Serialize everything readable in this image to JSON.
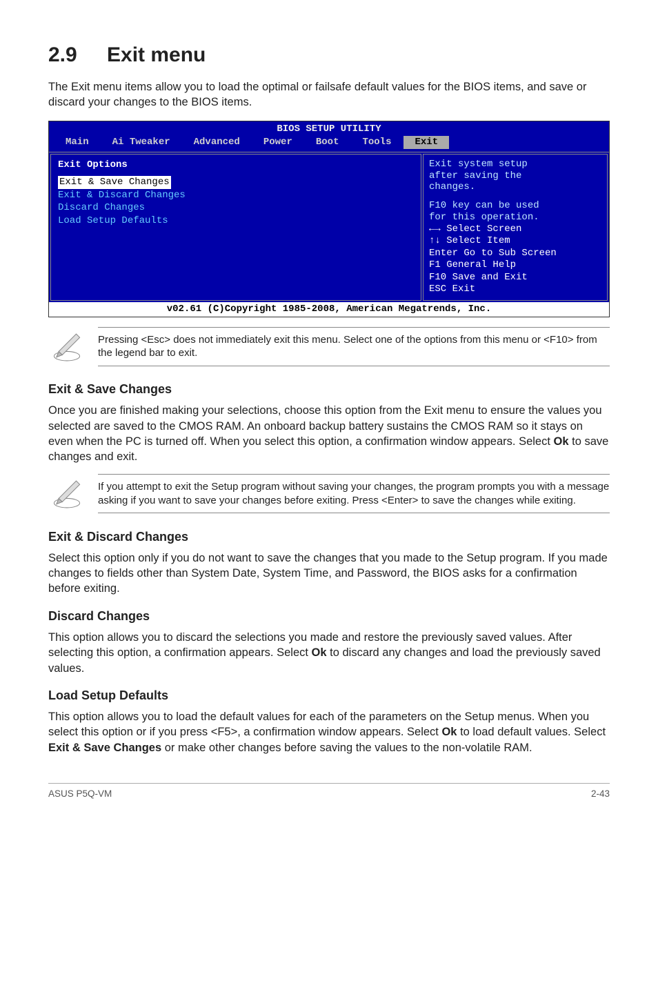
{
  "h1_num": "2.9",
  "h1_title": "Exit menu",
  "intro": "The Exit menu items allow you to load the optimal or failsafe default values for the BIOS items, and save or discard your changes to the BIOS items.",
  "bios": {
    "title": "BIOS SETUP UTILITY",
    "tabs": [
      "Main",
      "Ai Tweaker",
      "Advanced",
      "Power",
      "Boot",
      "Tools",
      "Exit"
    ],
    "active_tab": "Exit",
    "left_header": "Exit Options",
    "left_rows": [
      "Exit & Save Changes",
      "Exit & Discard Changes",
      "Discard Changes",
      "",
      "Load Setup Defaults"
    ],
    "help": [
      "Exit system setup",
      "after saving the",
      "changes.",
      "",
      "F10 key can be used",
      "for this operation."
    ],
    "legend": [
      "←→   Select Screen",
      "↑↓   Select Item",
      "Enter Go to Sub Screen",
      "F1   General Help",
      "F10  Save and Exit",
      "ESC  Exit"
    ],
    "foot": "v02.61 (C)Copyright 1985-2008, American Megatrends, Inc."
  },
  "note1": "Pressing <Esc> does not immediately exit this menu. Select one of the options from this menu or <F10> from the legend bar to exit.",
  "s1_h": "Exit & Save Changes",
  "s1_p": "Once you are finished making your selections, choose this option from the Exit menu to ensure the values you selected are saved to the CMOS RAM. An onboard backup battery sustains the CMOS RAM so it stays on even when the PC is turned off. When you select this option, a confirmation window appears. Select Ok to save changes and exit.",
  "note2": "If you attempt to exit the Setup program without saving your changes, the program prompts you with a message asking if you want to save your changes before exiting. Press <Enter> to save the changes while exiting.",
  "s2_h": "Exit & Discard Changes",
  "s2_p": "Select this option only if you do not want to save the changes that you  made to the Setup program. If you made changes to fields other than System Date, System Time, and Password, the BIOS asks for a confirmation before exiting.",
  "s3_h": "Discard Changes",
  "s3_p": "This option allows you to discard the selections you made and restore the previously saved values. After selecting this option, a confirmation appears. Select Ok to discard any changes and load the previously saved values.",
  "s4_h": "Load Setup Defaults",
  "s4_p": "This option allows you to load the default values for each of the parameters on the Setup menus. When you select this option or if you press <F5>, a confirmation window appears. Select Ok to load default values. Select Exit & Save Changes or make other changes before saving the values to the non-volatile RAM.",
  "footer_left": "ASUS P5Q-VM",
  "footer_right": "2-43"
}
